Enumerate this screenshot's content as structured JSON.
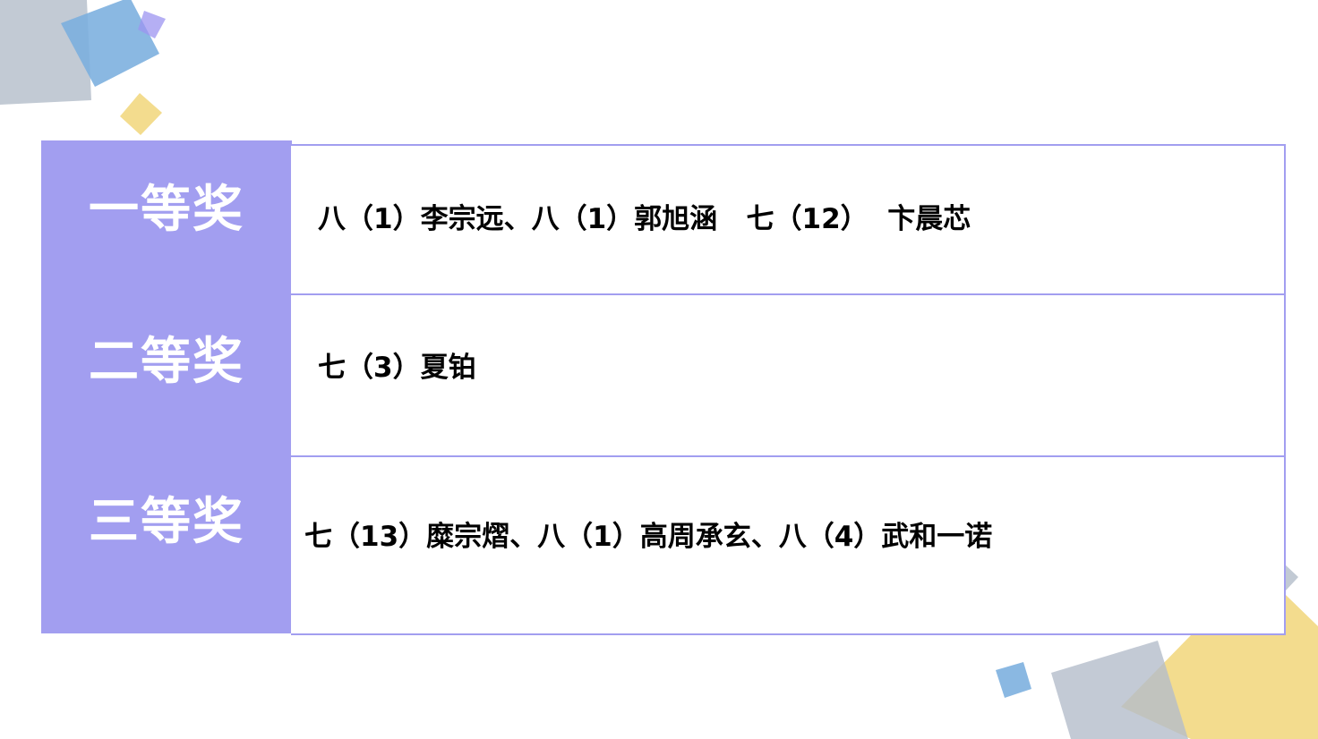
{
  "colors": {
    "accent": "#a29ef0",
    "gray": "#c2cad4",
    "blue": "#8ab8e2",
    "yellow": "#f3dc8e",
    "violet": "#b3acf2"
  },
  "awards": [
    {
      "label": "一等奖",
      "winners": "八（1）李宗远、八（1）郭旭涵   七（12）  卞晨芯"
    },
    {
      "label": "二等奖",
      "winners": "七（3）夏铂"
    },
    {
      "label": "三等奖",
      "winners": "七（13）糜宗熠、八（1）高周承玄、八（4）武和一诺"
    }
  ]
}
